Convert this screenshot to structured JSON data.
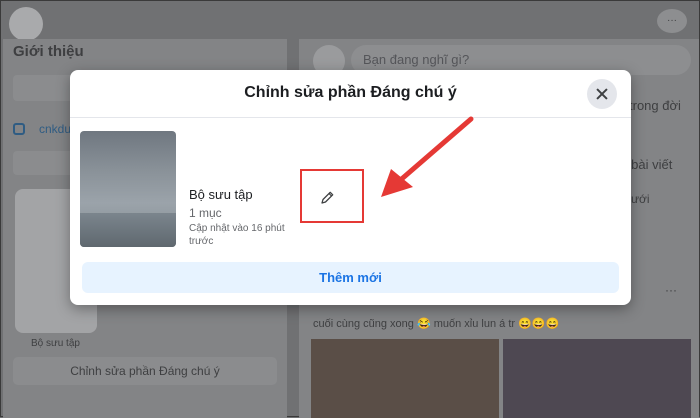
{
  "background": {
    "profile_section_title": "Giới thiệu",
    "instagram_text": "cnkdu",
    "collection_caption": "Bộ sưu tập",
    "edit_featured_button": "Chỉnh sửa phần Đáng chú ý",
    "post_placeholder": "Bạn đang nghĩ gì?",
    "peek_text_1": "trong đời",
    "peek_text_2": "ý bài viết",
    "peek_text_3": "ưới",
    "peek_dots": "···",
    "top_dots": "···",
    "post_caption": "cuối cùng cũng xong 😂 muốn xỉu lun á tr 😄😄😄"
  },
  "modal": {
    "title": "Chỉnh sửa phần Đáng chú ý",
    "collection": {
      "name": "Bộ sưu tập",
      "count": "1 mục",
      "updated": "Cập nhật vào 16 phút trước"
    },
    "add_button_label": "Thêm mới"
  },
  "colors": {
    "accent": "#1b74e4",
    "add_button_bg": "#e7f3ff",
    "highlight": "#e53935"
  },
  "icons": {
    "close": "close-icon",
    "edit": "pencil-icon",
    "instagram": "instagram-icon",
    "annotation": "red-arrow-icon"
  }
}
